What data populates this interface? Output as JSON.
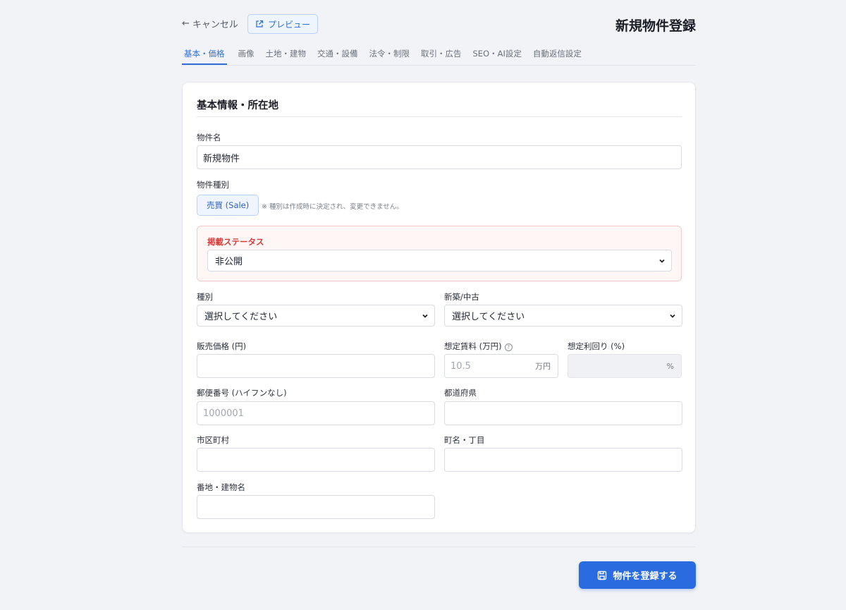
{
  "header": {
    "cancel_label": "キャンセル",
    "preview_label": "プレビュー",
    "title": "新規物件登録"
  },
  "tabs": [
    {
      "label": "基本・価格",
      "active": true
    },
    {
      "label": "画像"
    },
    {
      "label": "土地・建物"
    },
    {
      "label": "交通・設備"
    },
    {
      "label": "法令・制限"
    },
    {
      "label": "取引・広告"
    },
    {
      "label": "SEO・AI設定"
    },
    {
      "label": "自動返信設定"
    }
  ],
  "section": {
    "title": "基本情報・所在地"
  },
  "form": {
    "property_name": {
      "label": "物件名",
      "value": "新規物件"
    },
    "property_type": {
      "label": "物件種別",
      "value": "売買 (Sale)",
      "note": "※ 種別は作成時に決定され、変更できません。"
    },
    "status": {
      "label": "掲載ステータス",
      "value": "非公開"
    },
    "kind": {
      "label": "種別",
      "value": "選択してください"
    },
    "new_used": {
      "label": "新築/中古",
      "value": "選択してください"
    },
    "price": {
      "label": "販売価格 (円)",
      "value": ""
    },
    "rent": {
      "label": "想定賃料 (万円)",
      "placeholder": "10.5",
      "unit": "万円"
    },
    "yield": {
      "label": "想定利回り (%)",
      "unit": "%"
    },
    "postal": {
      "label": "郵便番号 (ハイフンなし)",
      "placeholder": "1000001"
    },
    "prefecture": {
      "label": "都道府県",
      "value": ""
    },
    "city": {
      "label": "市区町村",
      "value": ""
    },
    "town": {
      "label": "町名・丁目",
      "value": ""
    },
    "address": {
      "label": "番地・建物名",
      "value": ""
    }
  },
  "footer": {
    "submit_label": "物件を登録する"
  },
  "colors": {
    "accent": "#2a6ce0",
    "status_red": "#d73a3a",
    "background": "#f2f3f6"
  }
}
